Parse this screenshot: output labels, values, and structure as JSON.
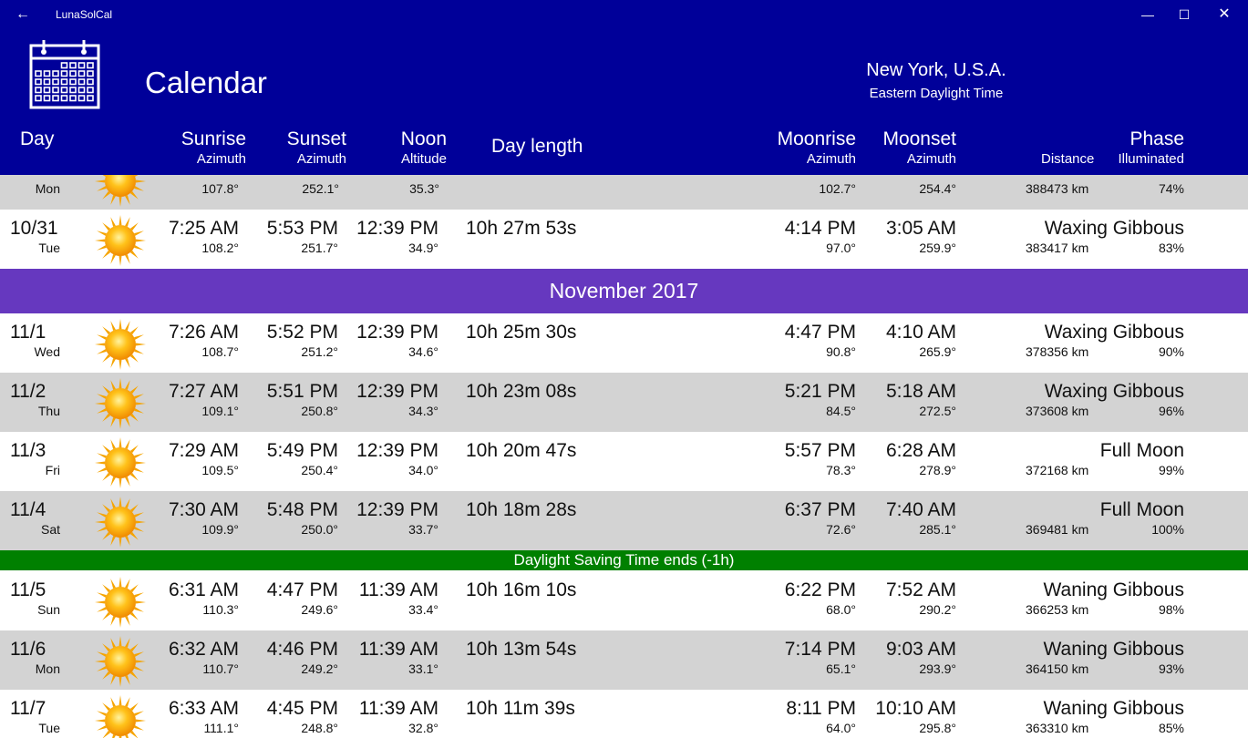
{
  "window": {
    "title": "LunaSolCal",
    "back_icon": "arrow-left-icon",
    "min_icon": "minimize-icon",
    "max_icon": "maximize-icon",
    "close_icon": "close-icon"
  },
  "header": {
    "title": "Calendar",
    "location": "New York, U.S.A.",
    "timezone": "Eastern Daylight Time",
    "icon": "calendar-icon",
    "bg_color": "#000099"
  },
  "columns": {
    "day": "Day",
    "sunrise": "Sunrise",
    "sunrise_sub": "Azimuth",
    "sunset": "Sunset",
    "sunset_sub": "Azimuth",
    "noon": "Noon",
    "noon_sub": "Altitude",
    "daylength": "Day length",
    "moonrise": "Moonrise",
    "moonrise_sub": "Azimuth",
    "moonset": "Moonset",
    "moonset_sub": "Azimuth",
    "distance": "Distance",
    "phase": "Phase",
    "phase_sub": "Illuminated"
  },
  "partial_row": {
    "weekday": "Mon",
    "sunrise_az": "107.8°",
    "sunset_az": "252.1°",
    "noon_alt": "35.3°",
    "moonrise_az": "102.7°",
    "moonset_az": "254.4°",
    "distance": "388473 km",
    "illum": "74%"
  },
  "rows_oct": [
    {
      "date": "10/31",
      "weekday": "Tue",
      "sunrise": "7:25 AM",
      "sunrise_az": "108.2°",
      "sunset": "5:53 PM",
      "sunset_az": "251.7°",
      "noon": "12:39 PM",
      "noon_alt": "34.9°",
      "daylength": "10h 27m 53s",
      "moonrise": "4:14 PM",
      "moonrise_az": "97.0°",
      "moonset": "3:05 AM",
      "moonset_az": "259.9°",
      "phase": "Waxing Gibbous",
      "distance": "383417 km",
      "illum": "83%"
    }
  ],
  "month_banner": "November 2017",
  "rows_nov_a": [
    {
      "date": "11/1",
      "weekday": "Wed",
      "sunrise": "7:26 AM",
      "sunrise_az": "108.7°",
      "sunset": "5:52 PM",
      "sunset_az": "251.2°",
      "noon": "12:39 PM",
      "noon_alt": "34.6°",
      "daylength": "10h 25m 30s",
      "moonrise": "4:47 PM",
      "moonrise_az": "90.8°",
      "moonset": "4:10 AM",
      "moonset_az": "265.9°",
      "phase": "Waxing Gibbous",
      "distance": "378356 km",
      "illum": "90%"
    },
    {
      "date": "11/2",
      "weekday": "Thu",
      "sunrise": "7:27 AM",
      "sunrise_az": "109.1°",
      "sunset": "5:51 PM",
      "sunset_az": "250.8°",
      "noon": "12:39 PM",
      "noon_alt": "34.3°",
      "daylength": "10h 23m 08s",
      "moonrise": "5:21 PM",
      "moonrise_az": "84.5°",
      "moonset": "5:18 AM",
      "moonset_az": "272.5°",
      "phase": "Waxing Gibbous",
      "distance": "373608 km",
      "illum": "96%"
    },
    {
      "date": "11/3",
      "weekday": "Fri",
      "sunrise": "7:29 AM",
      "sunrise_az": "109.5°",
      "sunset": "5:49 PM",
      "sunset_az": "250.4°",
      "noon": "12:39 PM",
      "noon_alt": "34.0°",
      "daylength": "10h 20m 47s",
      "moonrise": "5:57 PM",
      "moonrise_az": "78.3°",
      "moonset": "6:28 AM",
      "moonset_az": "278.9°",
      "phase": "Full Moon",
      "distance": "372168 km",
      "illum": "99%"
    },
    {
      "date": "11/4",
      "weekday": "Sat",
      "sunrise": "7:30 AM",
      "sunrise_az": "109.9°",
      "sunset": "5:48 PM",
      "sunset_az": "250.0°",
      "noon": "12:39 PM",
      "noon_alt": "33.7°",
      "daylength": "10h 18m 28s",
      "moonrise": "6:37 PM",
      "moonrise_az": "72.6°",
      "moonset": "7:40 AM",
      "moonset_az": "285.1°",
      "phase": "Full Moon",
      "distance": "369481 km",
      "illum": "100%"
    }
  ],
  "dst_banner": "Daylight Saving Time ends (-1h)",
  "rows_nov_b": [
    {
      "date": "11/5",
      "weekday": "Sun",
      "sunrise": "6:31 AM",
      "sunrise_az": "110.3°",
      "sunset": "4:47 PM",
      "sunset_az": "249.6°",
      "noon": "11:39 AM",
      "noon_alt": "33.4°",
      "daylength": "10h 16m 10s",
      "moonrise": "6:22 PM",
      "moonrise_az": "68.0°",
      "moonset": "7:52 AM",
      "moonset_az": "290.2°",
      "phase": "Waning Gibbous",
      "distance": "366253 km",
      "illum": "98%"
    },
    {
      "date": "11/6",
      "weekday": "Mon",
      "sunrise": "6:32 AM",
      "sunrise_az": "110.7°",
      "sunset": "4:46 PM",
      "sunset_az": "249.2°",
      "noon": "11:39 AM",
      "noon_alt": "33.1°",
      "daylength": "10h 13m 54s",
      "moonrise": "7:14 PM",
      "moonrise_az": "65.1°",
      "moonset": "9:03 AM",
      "moonset_az": "293.9°",
      "phase": "Waning Gibbous",
      "distance": "364150 km",
      "illum": "93%"
    },
    {
      "date": "11/7",
      "weekday": "Tue",
      "sunrise": "6:33 AM",
      "sunrise_az": "111.1°",
      "sunset": "4:45 PM",
      "sunset_az": "248.8°",
      "noon": "11:39 AM",
      "noon_alt": "32.8°",
      "daylength": "10h 11m 39s",
      "moonrise": "8:11 PM",
      "moonrise_az": "64.0°",
      "moonset": "10:10 AM",
      "moonset_az": "295.8°",
      "phase": "Waning Gibbous",
      "distance": "363310 km",
      "illum": "85%"
    }
  ],
  "colors": {
    "header": "#000099",
    "month_banner": "#6638bf",
    "dst_banner": "#008000",
    "row_alt": "#d3d3d3"
  },
  "row_icon": "sun-icon"
}
